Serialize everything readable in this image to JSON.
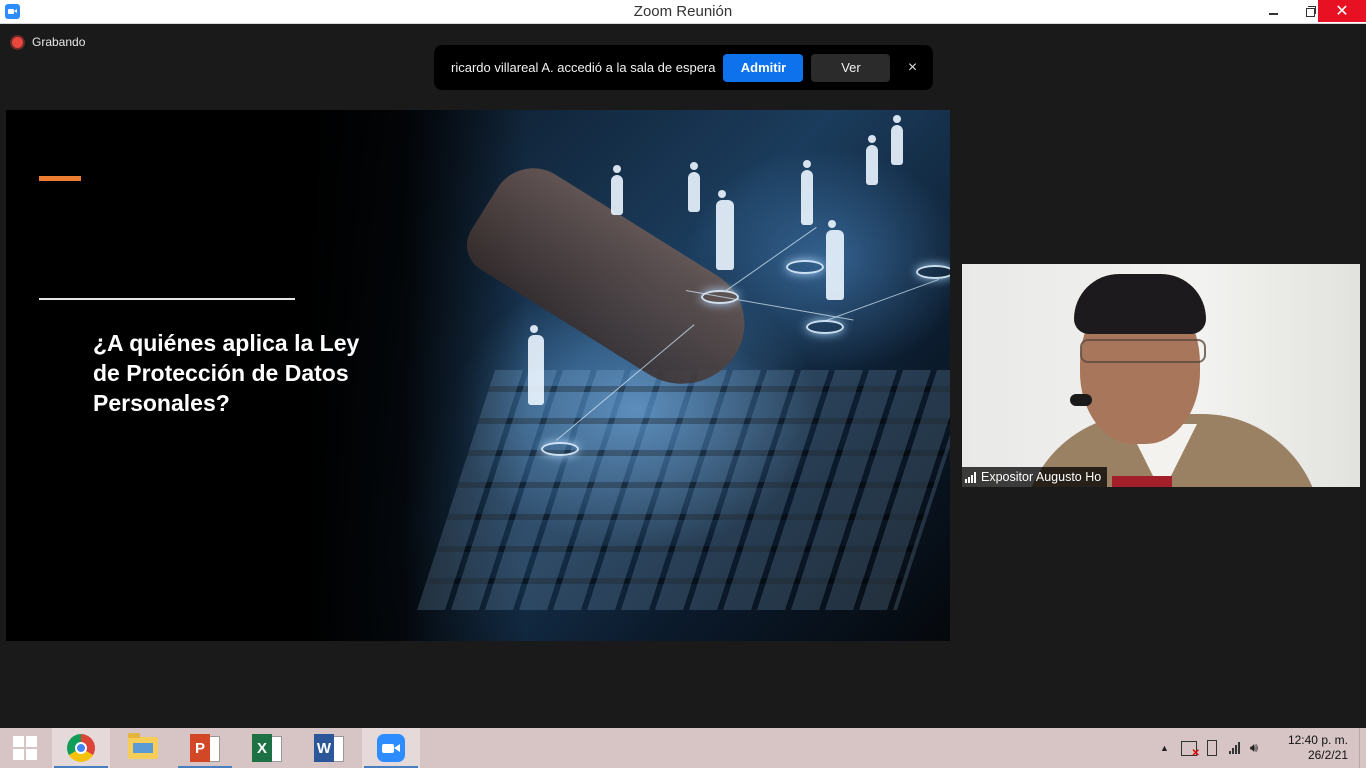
{
  "window": {
    "title": "Zoom Reunión"
  },
  "recording": {
    "label": "Grabando"
  },
  "notification": {
    "message": "ricardo villareal  A. accedió a la sala de espera",
    "admit_label": "Admitir",
    "view_label": "Ver",
    "close_glyph": "×"
  },
  "slide": {
    "title": "¿A quiénes aplica la Ley de Protección de Datos Personales?",
    "accent_color": "#ed7d31"
  },
  "participant": {
    "name": "Expositor Augusto Ho"
  },
  "taskbar": {
    "apps": [
      {
        "name": "start",
        "icon": "windows-icon"
      },
      {
        "name": "chrome",
        "icon": "chrome-icon"
      },
      {
        "name": "file-explorer",
        "icon": "folder-icon"
      },
      {
        "name": "powerpoint",
        "icon": "powerpoint-icon",
        "letter": "P"
      },
      {
        "name": "excel",
        "icon": "excel-icon",
        "letter": "X"
      },
      {
        "name": "word",
        "icon": "word-icon",
        "letter": "W"
      },
      {
        "name": "zoom",
        "icon": "zoom-icon"
      }
    ],
    "clock_time": "12:40 p. m.",
    "clock_date": "26/2/21",
    "tray_chevron": "▲"
  },
  "colors": {
    "zoom_blue": "#0e72ed",
    "recording_red": "#e8473e",
    "close_red": "#e81123",
    "taskbar": "#d7c5c6"
  }
}
